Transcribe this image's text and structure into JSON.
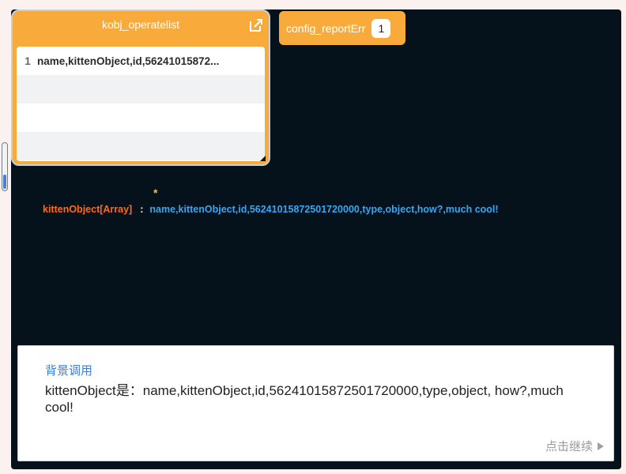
{
  "list": {
    "title": "kobj_operatelist",
    "rows": [
      {
        "index": "1",
        "value": "name,kittenObject,id,56241015872..."
      },
      {
        "index": "",
        "value": ""
      },
      {
        "index": "",
        "value": ""
      },
      {
        "index": "",
        "value": ""
      }
    ]
  },
  "broadcast": {
    "label": "config_reportErr",
    "count": "1"
  },
  "variable": {
    "marker": "*",
    "name": "kittenObject[Array]",
    "separator": ":",
    "value": "name,kittenObject,id,56241015872501720000,type,object,how?,much cool!"
  },
  "dialog": {
    "speaker": "背景调用",
    "message": "kittenObject是：name,kittenObject,id,56241015872501720000,type,object, how?,much cool!",
    "continue_label": "点击继续"
  },
  "colors": {
    "stage_bg": "#06121b",
    "accent_orange": "#f8ab3b",
    "var_name": "#ff6a1c",
    "var_value": "#36a8f2",
    "speaker": "#3d7ed8"
  }
}
